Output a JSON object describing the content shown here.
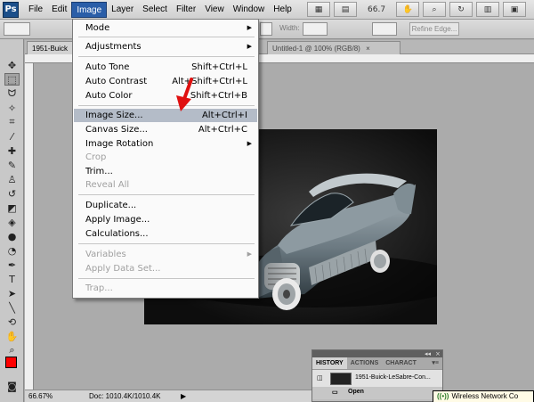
{
  "app": {
    "logo": "Ps"
  },
  "menubar": [
    "File",
    "Edit",
    "Image",
    "Layer",
    "Select",
    "Filter",
    "View",
    "Window",
    "Help"
  ],
  "appbar": {
    "zoom": "66.7"
  },
  "options": {
    "width_label": "Width:",
    "refine_edge": "Refine Edge..."
  },
  "tabs": {
    "doc1": "1951-Buick",
    "doc2": "Untitled-1 @ 100% (RGB/8)"
  },
  "status": {
    "zoom": "66.67%",
    "doc": "Doc: 1010.4K/1010.4K"
  },
  "history": {
    "tabs": [
      "HISTORY",
      "ACTIONS",
      "CHARACT"
    ],
    "snapshot": "1951-Buick-LeSabre-Con...",
    "open_step": "Open"
  },
  "tray": {
    "label": "Wireless Network Co"
  },
  "image_menu": {
    "items": [
      {
        "label": "Mode",
        "submenu": true
      },
      {
        "label": "Adjustments",
        "submenu": true
      },
      {
        "label": "Auto Tone",
        "shortcut": "Shift+Ctrl+L"
      },
      {
        "label": "Auto Contrast",
        "shortcut": "Alt+Shift+Ctrl+L"
      },
      {
        "label": "Auto Color",
        "shortcut": "Shift+Ctrl+B"
      },
      {
        "label": "Image Size...",
        "shortcut": "Alt+Ctrl+I",
        "highlighted": true
      },
      {
        "label": "Canvas Size...",
        "shortcut": "Alt+Ctrl+C"
      },
      {
        "label": "Image Rotation",
        "submenu": true
      },
      {
        "label": "Crop",
        "disabled": true
      },
      {
        "label": "Trim..."
      },
      {
        "label": "Reveal All",
        "disabled": true
      },
      {
        "label": "Duplicate..."
      },
      {
        "label": "Apply Image..."
      },
      {
        "label": "Calculations..."
      },
      {
        "label": "Variables",
        "disabled": true,
        "submenu": true
      },
      {
        "label": "Apply Data Set...",
        "disabled": true
      },
      {
        "label": "Trap...",
        "disabled": true
      }
    ]
  },
  "colors": {
    "foreground": "#ff0000",
    "background": "#ffffff",
    "menu_highlight": "#b4bcc8",
    "active_menu": "#2a5ea8",
    "annotation_arrow": "#e01010"
  }
}
